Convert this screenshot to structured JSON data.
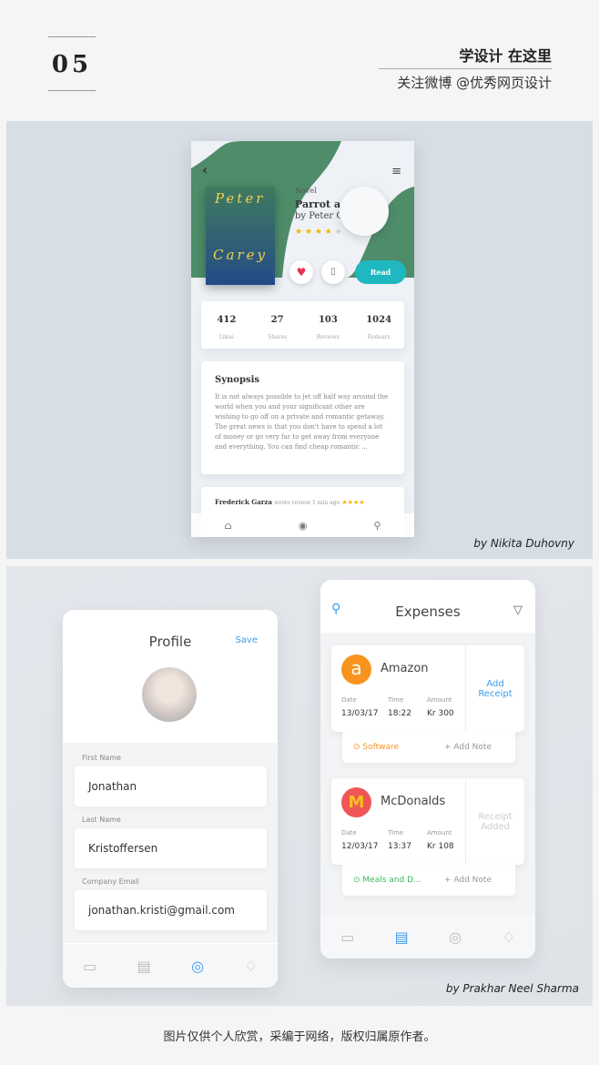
{
  "header": {
    "number": "05",
    "title": "学设计 在这里",
    "subtitle": "关注微博 @优秀网页设计"
  },
  "book": {
    "genre": "Novel",
    "title": "Parrot a",
    "author": "by Peter C",
    "cover_lines": [
      "Peter",
      "Carey"
    ],
    "rating": 4,
    "read_label": "Read",
    "stats": [
      {
        "value": "412",
        "label": "Likes"
      },
      {
        "value": "27",
        "label": "Shares"
      },
      {
        "value": "103",
        "label": "Reviews"
      },
      {
        "value": "1024",
        "label": "Redears"
      }
    ],
    "synopsis_title": "Synopsis",
    "synopsis": "It is not always possible to jet off half way around the world when you and your significant other are wishing to go off on a private and romantic getaway. The great news is that you don't have to spend a lot of money or go very far to get away from everyone and everything. You can find cheap romantic ...",
    "review": {
      "author": "Frederick Garza",
      "meta": "wrote review 1 min ago",
      "rating": 4
    },
    "accent_green": "#4f8c6a",
    "accent_teal": "#1fb8c0",
    "credit": "by Nikita Duhovny"
  },
  "profile": {
    "title": "Profile",
    "save": "Save",
    "fields": [
      {
        "label": "First Name",
        "value": "Jonathan"
      },
      {
        "label": "Last Name",
        "value": "Kristoffersen"
      },
      {
        "label": "Company Email",
        "value": "jonathan.kristi@gmail.com"
      }
    ]
  },
  "expenses": {
    "title": "Expenses",
    "labels": {
      "date": "Date",
      "time": "Time",
      "amount": "Amount",
      "add_note": "+ Add Note"
    },
    "items": [
      {
        "name": "Amazon",
        "date": "13/03/17",
        "time": "18:22",
        "amount": "Kr 300",
        "action": "Add Receipt",
        "category": "Software",
        "color": "#f7931e"
      },
      {
        "name": "McDonalds",
        "date": "12/03/17",
        "time": "13:37",
        "amount": "Kr 108",
        "action": "Receipt Added",
        "category": "Meals and D...",
        "color": "#f05656"
      }
    ],
    "credit": "by Prakhar Neel Sharma"
  },
  "footer": "图片仅供个人欣赏，采编于网络，版权归属原作者。"
}
